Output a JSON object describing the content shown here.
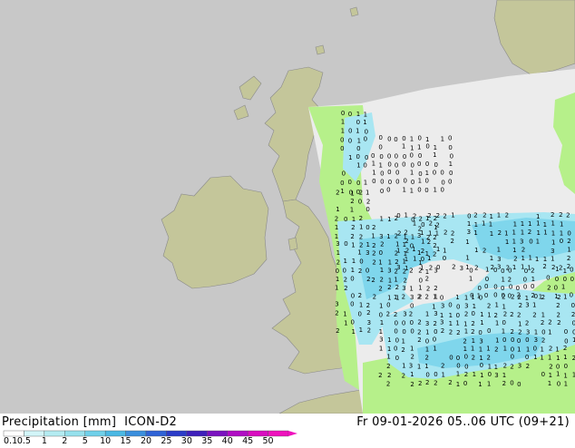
{
  "title": {
    "variable": "Precipitation [mm]",
    "model": "ICON-D2",
    "valid_time": "Fr 09-01-2026 05..06 UTC (09+21)"
  },
  "legend": {
    "labels": [
      "0.1",
      "0.5",
      "1",
      "2",
      "5",
      "10",
      "15",
      "20",
      "25",
      "30",
      "35",
      "40",
      "45",
      "50"
    ],
    "colors": [
      "#ffffff",
      "#d2f5f8",
      "#b4ecf2",
      "#96e1ed",
      "#6fd0ea",
      "#4ab8e4",
      "#3a8fde",
      "#2e62d6",
      "#2b3bc8",
      "#3e1fbb",
      "#7a12c0",
      "#b00dc4",
      "#d90cc0",
      "#ef11bd"
    ]
  },
  "map": {
    "colors": {
      "sea": "#c8c8c8",
      "land": "#c4c69a",
      "model_domain": "#ececec",
      "light_precip": "#b6f08a",
      "precip_1": "#a8e6f2",
      "precip_2": "#7fd6ec",
      "coast": "#8a8a8a"
    },
    "value_labels": [
      "0",
      "1",
      "2",
      "3"
    ]
  }
}
